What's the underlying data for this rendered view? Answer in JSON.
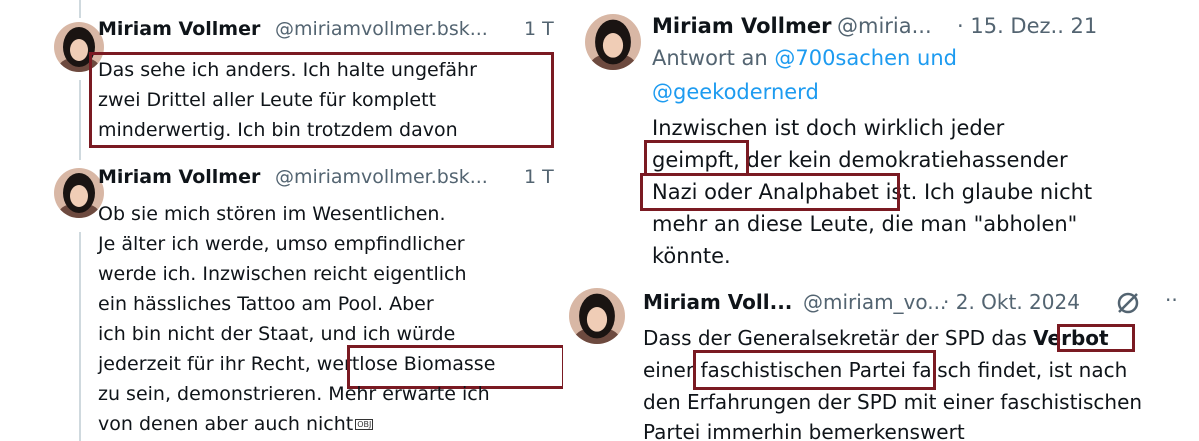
{
  "panel1": {
    "tweet1": {
      "name": "Miriam Vollmer",
      "handle": "@miriamvollmer.bsk...",
      "time": "1 T",
      "lines": [
        "Das sehe ich anders. Ich halte ungefähr",
        "zwei Drittel aller Leute für komplett",
        "minderwertig. Ich bin trotzdem davon"
      ]
    },
    "tweet2": {
      "name": "Miriam Vollmer",
      "handle": "@miriamvollmer.bsk...",
      "time": "1 T",
      "lines": [
        "Ob sie mich stören im Wesentlichen.",
        "Je älter ich werde, umso empfindlicher",
        "werde ich. Inzwischen reicht eigentlich",
        "ein hässliches Tattoo am Pool. Aber",
        "ich bin nicht der Staat, und ich würde",
        "jederzeit für ihr Recht, ",
        "zu sein, demonstrieren. Mehr erwarte ich",
        "von denen aber auch nicht"
      ],
      "highlight": "wertlose Biomasse",
      "obj_glyph": "OBJ"
    }
  },
  "panel2": {
    "name": "Miriam Vollmer",
    "handle": "@miria...",
    "time": "· 15. Dez.. 21",
    "reply_prefix": "Antwort an",
    "mention1": "@700sachen",
    "reply_and": "und",
    "mention2": "@geekodernerd",
    "line1": "Inzwischen ist doch wirklich jeder",
    "hl1": "geimpft,",
    "line2_rest": "der kein demokratiehassender",
    "hl2": "Nazi oder Analphabet",
    "line3_rest": "ist. Ich glaube nicht",
    "line4": "mehr an diese Leute, die man \"abholen\"",
    "line5": "könnte."
  },
  "panel3": {
    "name": "Miriam Voll...",
    "handle": "@miriam_vo...",
    "time": "· 2. Okt. 2024",
    "more": "··",
    "line1_pre": "Dass der Generalsekretär der SPD das",
    "hl1": "Verbot",
    "line2_pre": "einer",
    "hl2": "faschistischen Partei",
    "line2_post": "falsch findet, ist nach",
    "line3": "den Erfahrungen der SPD mit einer faschistischen",
    "line4": "Partei immerhin bemerkenswert"
  },
  "colors": {
    "highlight_box": "#7a1a22",
    "mention": "#1d9bf0",
    "secondary_text": "#536471",
    "thread_line": "#cfd9de"
  }
}
